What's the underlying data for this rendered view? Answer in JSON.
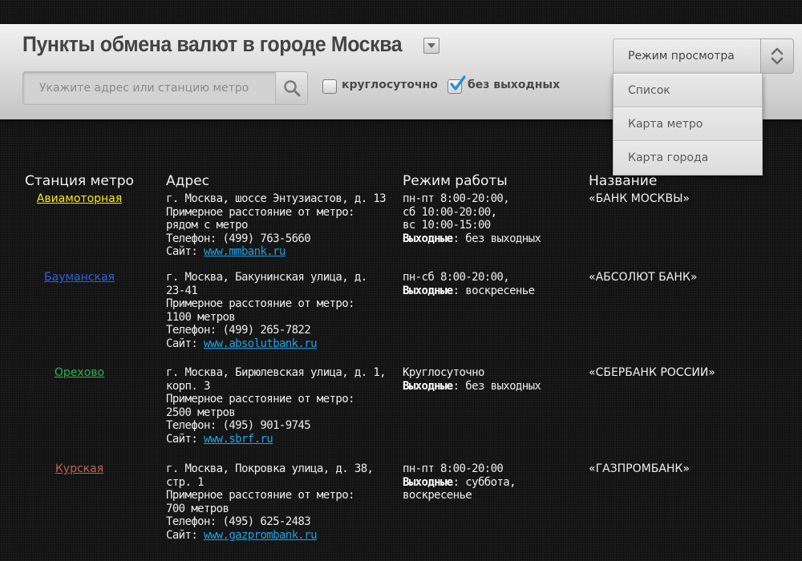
{
  "header": {
    "title": "Пункты обмена валют в городе Москва",
    "search": {
      "placeholder": "Укажите адрес или станцию метро",
      "value": ""
    },
    "filters": [
      {
        "label": "круглосуточно",
        "checked": false
      },
      {
        "label": "без выходных",
        "checked": true
      }
    ],
    "view_mode": {
      "label": "Режим просмотра",
      "options": [
        "Список",
        "Карта метро",
        "Карта города"
      ]
    }
  },
  "columns": [
    "Станция метро",
    "Адрес",
    "Режим работы",
    "Название"
  ],
  "station_colors": [
    "#ffee00",
    "#2b62e0",
    "#2eb34a",
    "#c0614d"
  ],
  "rows": [
    {
      "station": "Авиамоторная",
      "address_lines": [
        "г. Москва, шоссе Энтузиастов, д. 13",
        "Примерное расстояние от метро:",
        "рядом с метро",
        "Телефон: (499) 763-5660"
      ],
      "site_label": "Сайт:",
      "site": "www.mmbank.ru",
      "hours_lines": [
        "пн-пт 8:00-20:00,",
        "сб 10:00-20:00,",
        "вс 10:00-15:00"
      ],
      "days_off_label": "Выходные",
      "days_off": ": без выходных",
      "days_off_extra": "",
      "bank": "«БАНК МОСКВЫ»"
    },
    {
      "station": "Бауманская",
      "address_lines": [
        "г. Москва, Бакунинская улица, д.",
        "23-41",
        "Примерное расстояние от метро:",
        "1100 метров",
        "Телефон: (499) 265-7822"
      ],
      "site_label": "Сайт:",
      "site": "www.absolutbank.ru",
      "hours_lines": [
        "пн-сб 8:00-20:00,"
      ],
      "days_off_label": "Выходные",
      "days_off": ": воскресенье",
      "days_off_extra": "",
      "bank": "«АБСОЛЮТ БАНК»"
    },
    {
      "station": "Орехово",
      "address_lines": [
        "г. Москва, Бирюлевская улица, д. 1,",
        "корп. 3",
        "Примерное расстояние от метро:",
        "2500 метров",
        "Телефон: (495) 901-9745"
      ],
      "site_label": "Сайт:",
      "site": "www.sbrf.ru",
      "hours_lines": [
        "Круглосуточно"
      ],
      "days_off_label": "Выходные",
      "days_off": ": без выходных",
      "days_off_extra": "",
      "bank": "«СБЕРБАНК РОССИИ»"
    },
    {
      "station": "Курская",
      "address_lines": [
        "г. Москва, Покровка улица, д. 38,",
        "стр. 1",
        "Примерное расстояние от метро:",
        "700 метров",
        "Телефон: (495) 625-2483"
      ],
      "site_label": "Сайт:",
      "site": "www.gazprombank.ru",
      "hours_lines": [
        "пн-пт 8:00-20:00"
      ],
      "days_off_label": "Выходные",
      "days_off": ": суббота,",
      "days_off_extra": "воскресенье",
      "bank": "«ГАЗПРОМБАНК»"
    }
  ]
}
